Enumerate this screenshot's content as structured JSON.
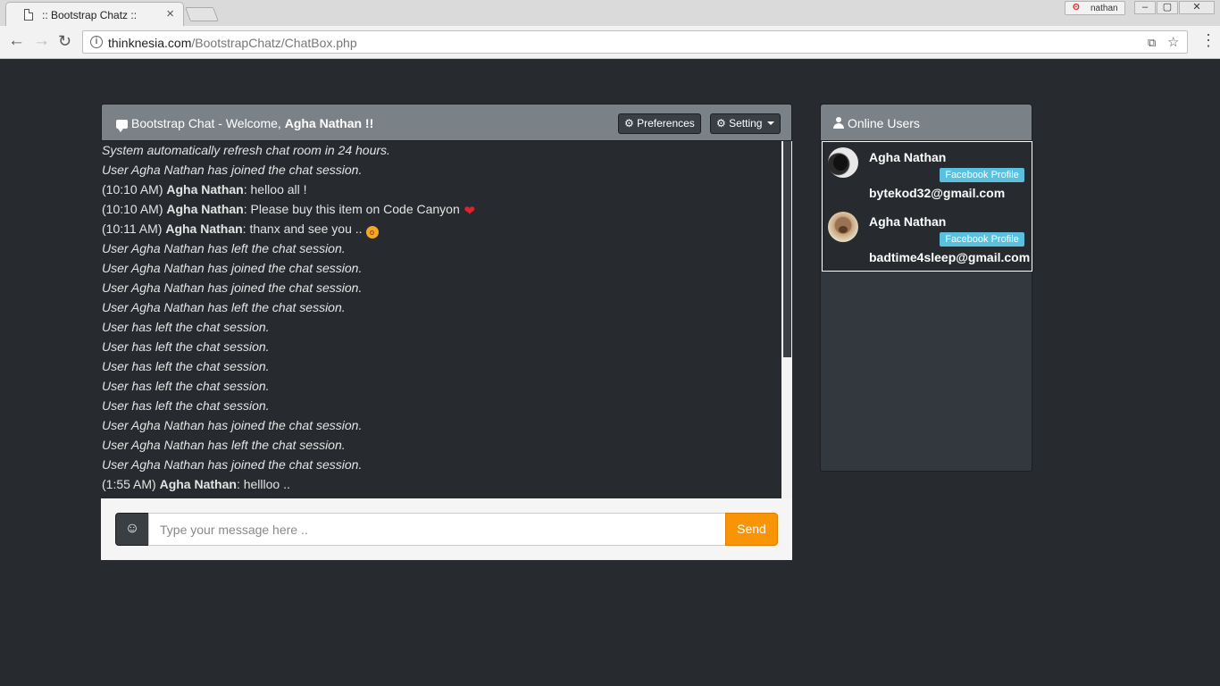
{
  "browser": {
    "tab_title": ":: Bootstrap Chatz ::",
    "tab_close": "×",
    "profile_name": "nathan",
    "window_controls": [
      "–",
      "▢",
      "✕"
    ],
    "url_host": "thinknesia.com",
    "url_path": "/BootstrapChatz/ChatBox.php"
  },
  "chat": {
    "title_prefix": "Bootstrap Chat - Welcome, ",
    "title_user": "Agha Nathan !!",
    "preferences_label": "Preferences",
    "setting_label": "Setting",
    "messages": [
      {
        "type": "system",
        "text": "System automatically refresh chat room in 24 hours."
      },
      {
        "type": "system",
        "text": "User Agha Nathan has joined the chat session."
      },
      {
        "type": "user",
        "time": "(10:10 AM)",
        "user": "Agha Nathan",
        "text": ": helloo all !"
      },
      {
        "type": "user",
        "time": "(10:10 AM)",
        "user": "Agha Nathan",
        "text": ": Please buy this item on Code Canyon",
        "emoji": "heart"
      },
      {
        "type": "user",
        "time": "(10:11 AM)",
        "user": "Agha Nathan",
        "text": ": thanx and see you ..",
        "emoji": "face"
      },
      {
        "type": "system",
        "text": "User Agha Nathan has left the chat session."
      },
      {
        "type": "system",
        "text": "User Agha Nathan has joined the chat session."
      },
      {
        "type": "system",
        "text": "User Agha Nathan has joined the chat session."
      },
      {
        "type": "system",
        "text": "User Agha Nathan has left the chat session."
      },
      {
        "type": "system",
        "text": "User has left the chat session."
      },
      {
        "type": "system",
        "text": "User has left the chat session."
      },
      {
        "type": "system",
        "text": "User has left the chat session."
      },
      {
        "type": "system",
        "text": "User has left the chat session."
      },
      {
        "type": "system",
        "text": "User has left the chat session."
      },
      {
        "type": "system",
        "text": "User Agha Nathan has joined the chat session."
      },
      {
        "type": "system",
        "text": "User Agha Nathan has left the chat session."
      },
      {
        "type": "system",
        "text": "User Agha Nathan has joined the chat session."
      },
      {
        "type": "user",
        "time": "(1:55 AM)",
        "user": "Agha Nathan",
        "text": ": hellloo .."
      }
    ],
    "input_placeholder": "Type your message here ..",
    "emoji_button": "☺",
    "send_label": "Send"
  },
  "online_users": {
    "title": "Online Users",
    "users": [
      {
        "name": "Agha Nathan",
        "badge": "Facebook Profile",
        "email": "bytekod32@gmail.com"
      },
      {
        "name": "Agha Nathan",
        "badge": "Facebook Profile",
        "email": "badtime4sleep@gmail.com"
      }
    ]
  },
  "colors": {
    "page_bg": "#272b30",
    "panel_header": "#7a8288",
    "send_button": "#f89406",
    "badge": "#5bc0de"
  }
}
